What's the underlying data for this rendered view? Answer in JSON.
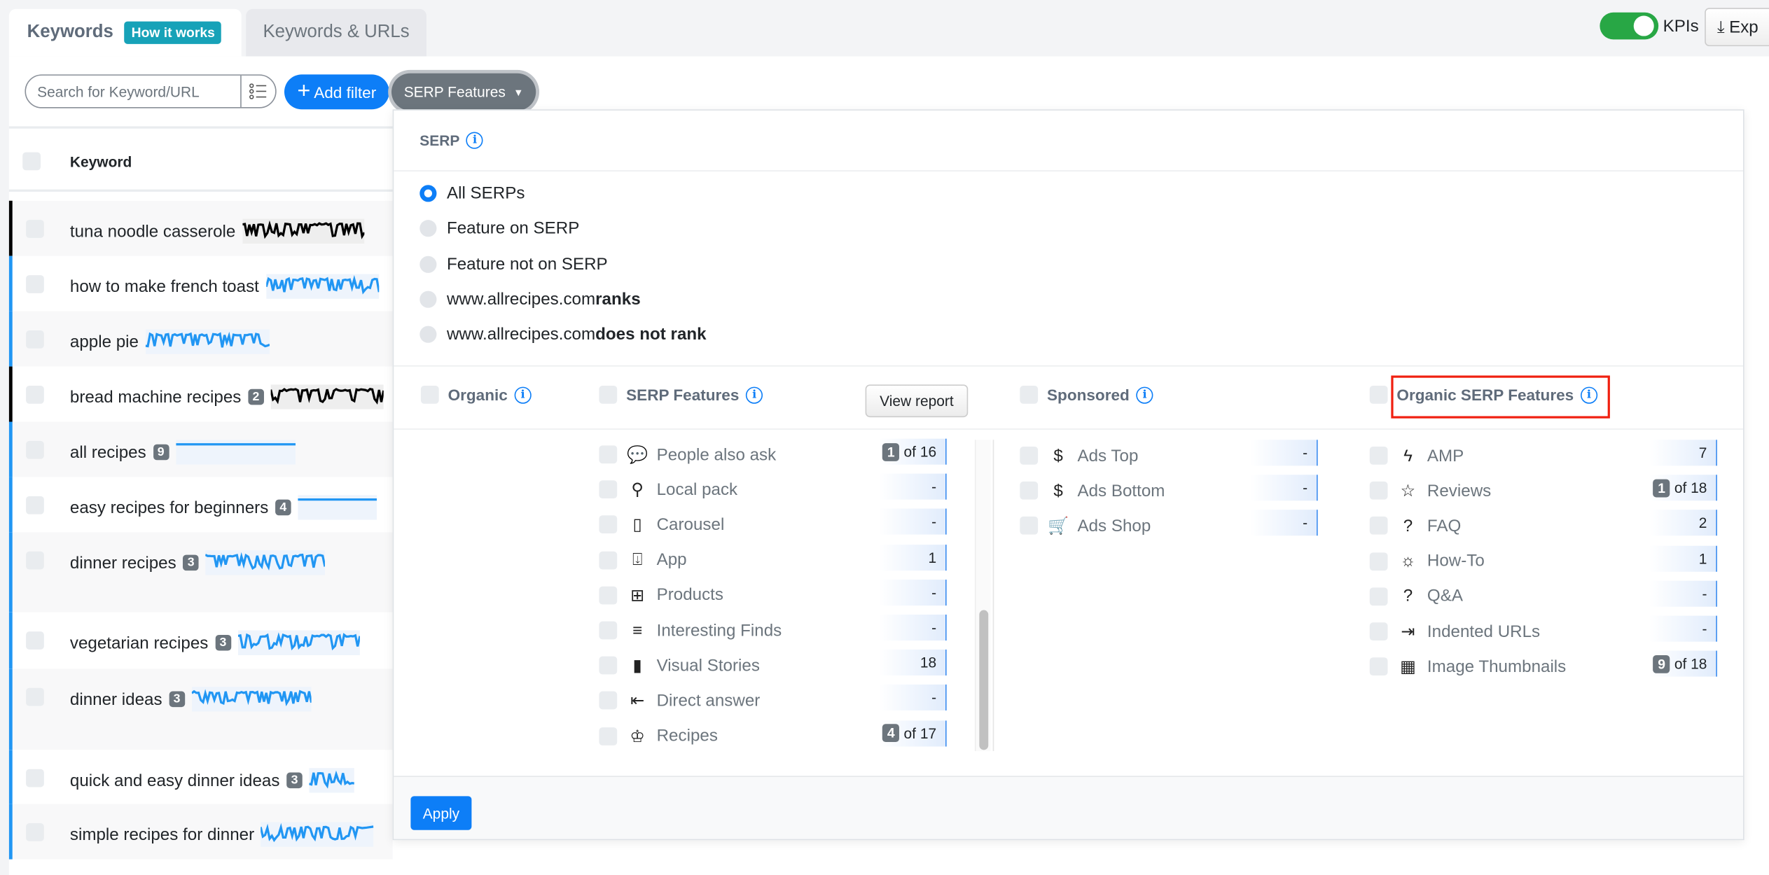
{
  "tabs": [
    {
      "label": "Keywords",
      "badge": "How it works"
    },
    {
      "label": "Keywords & URLs"
    }
  ],
  "toolbar": {
    "search_placeholder": "Search for Keyword/URL",
    "add_filter": "Add filter",
    "serp_features": "SERP Features",
    "kpis": "KPIs",
    "kpis_on": true,
    "export": "Exp"
  },
  "table": {
    "header": "Keyword",
    "rows": [
      {
        "keyword": "tuna noodle casserole",
        "badge": "",
        "color": "#000000"
      },
      {
        "keyword": "how to make french toast",
        "badge": "",
        "color": "#2196f3"
      },
      {
        "keyword": "apple pie",
        "badge": "",
        "color": "#2196f3"
      },
      {
        "keyword": "bread machine recipes",
        "badge": "2",
        "color": "#000000"
      },
      {
        "keyword": "all recipes",
        "badge": "9",
        "color": "#2196f3"
      },
      {
        "keyword": "easy recipes for beginners",
        "badge": "4",
        "color": "#2196f3"
      },
      {
        "keyword": "dinner recipes",
        "badge": "3",
        "color": "#2196f3"
      },
      {
        "keyword": "vegetarian recipes",
        "badge": "3",
        "color": "#2196f3"
      },
      {
        "keyword": "dinner ideas",
        "badge": "3",
        "color": "#2196f3"
      },
      {
        "keyword": "quick and easy dinner ideas",
        "badge": "3",
        "color": "#2196f3"
      },
      {
        "keyword": "simple recipes for dinner",
        "badge": "",
        "color": "#2196f3"
      }
    ]
  },
  "panel": {
    "serp_title": "SERP",
    "radios": [
      {
        "label": "All SERPs",
        "bold": "",
        "checked": true
      },
      {
        "label": "Feature on SERP",
        "bold": ""
      },
      {
        "label": "Feature not on SERP",
        "bold": ""
      },
      {
        "label": "www.allrecipes.com ",
        "bold": "ranks"
      },
      {
        "label": "www.allrecipes.com ",
        "bold": "does not rank"
      }
    ],
    "columns": {
      "organic": "Organic",
      "serp_features": "SERP Features",
      "view_report": "View report",
      "sponsored": "Sponsored",
      "organic_serp_features": "Organic SERP Features"
    },
    "serp_features": [
      {
        "label": "People also ask",
        "icon": "people-also-ask-icon",
        "badge": "1",
        "count": "of 16"
      },
      {
        "label": "Local pack",
        "icon": "local-pack-icon",
        "count": "-"
      },
      {
        "label": "Carousel",
        "icon": "carousel-icon",
        "count": "-"
      },
      {
        "label": "App",
        "icon": "app-icon",
        "count": "1"
      },
      {
        "label": "Products",
        "icon": "products-icon",
        "count": "-"
      },
      {
        "label": "Interesting Finds",
        "icon": "interesting-finds-icon",
        "count": "-"
      },
      {
        "label": "Visual Stories",
        "icon": "visual-stories-icon",
        "count": "18"
      },
      {
        "label": "Direct answer",
        "icon": "direct-answer-icon",
        "count": "-"
      },
      {
        "label": "Recipes",
        "icon": "recipes-icon",
        "badge": "4",
        "count": "of 17"
      }
    ],
    "sponsored": [
      {
        "label": "Ads Top",
        "icon": "ads-top-icon",
        "count": "-"
      },
      {
        "label": "Ads Bottom",
        "icon": "ads-bottom-icon",
        "count": "-"
      },
      {
        "label": "Ads Shop",
        "icon": "cart-icon",
        "count": "-"
      }
    ],
    "organic_features": [
      {
        "label": "AMP",
        "icon": "amp-icon",
        "count": "7"
      },
      {
        "label": "Reviews",
        "icon": "star-icon",
        "badge": "1",
        "count": "of 18"
      },
      {
        "label": "FAQ",
        "icon": "faq-icon",
        "count": "2"
      },
      {
        "label": "How-To",
        "icon": "lightbulb-icon",
        "count": "1"
      },
      {
        "label": "Q&A",
        "icon": "qa-icon",
        "count": "-"
      },
      {
        "label": "Indented URLs",
        "icon": "indent-icon",
        "count": "-"
      },
      {
        "label": "Image Thumbnails",
        "icon": "image-thumbnails-icon",
        "badge": "9",
        "count": "of 18"
      }
    ],
    "apply": "Apply"
  },
  "colors": {
    "accent": "#0d7ef7",
    "toggle": "#28a745",
    "highlight": "#f02010"
  }
}
